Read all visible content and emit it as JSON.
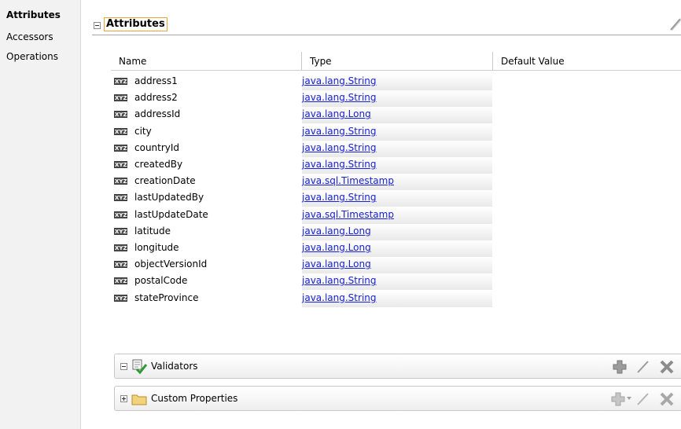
{
  "nav": {
    "items": [
      {
        "label": "Attributes",
        "active": true
      },
      {
        "label": "Accessors",
        "active": false
      },
      {
        "label": "Operations",
        "active": false
      }
    ]
  },
  "section": {
    "title": "Attributes",
    "columns": {
      "name": "Name",
      "type": "Type",
      "default": "Default Value"
    },
    "icon_label": "XYZ",
    "rows": [
      {
        "name": "address1",
        "type": "java.lang.String"
      },
      {
        "name": "address2",
        "type": "java.lang.String"
      },
      {
        "name": "addressId",
        "type": "java.lang.Long"
      },
      {
        "name": "city",
        "type": "java.lang.String"
      },
      {
        "name": "countryId",
        "type": "java.lang.String"
      },
      {
        "name": "createdBy",
        "type": "java.lang.String"
      },
      {
        "name": "creationDate",
        "type": "java.sql.Timestamp"
      },
      {
        "name": "lastUpdatedBy",
        "type": "java.lang.String"
      },
      {
        "name": "lastUpdateDate",
        "type": "java.sql.Timestamp"
      },
      {
        "name": "latitude",
        "type": "java.lang.Long"
      },
      {
        "name": "longitude",
        "type": "java.lang.Long"
      },
      {
        "name": "objectVersionId",
        "type": "java.lang.Long"
      },
      {
        "name": "postalCode",
        "type": "java.lang.String"
      },
      {
        "name": "stateProvince",
        "type": "java.lang.String"
      }
    ]
  },
  "validators": {
    "title": "Validators"
  },
  "custom_properties": {
    "title": "Custom Properties"
  },
  "colors": {
    "link": "#1a23d2",
    "focus_border": "#e9a33b"
  }
}
